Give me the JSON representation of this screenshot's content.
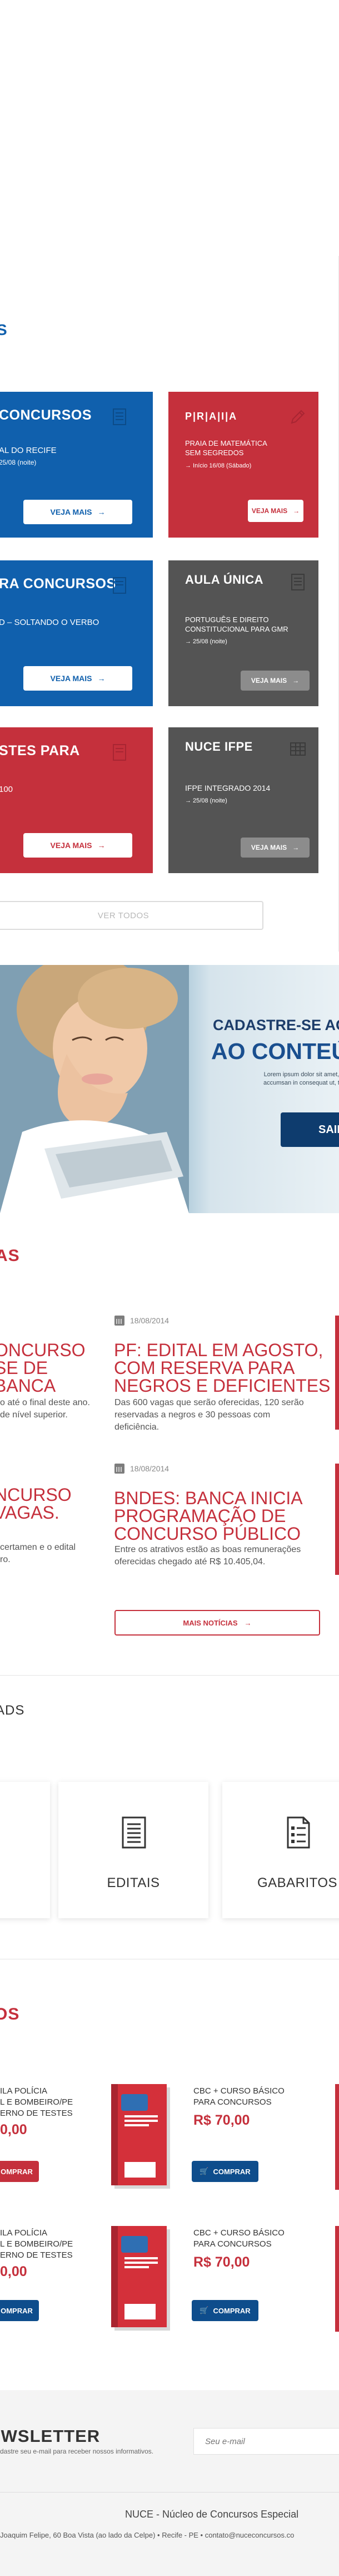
{
  "sections": {
    "courses_title_partial": "S",
    "news_title_partial": "AS",
    "downloads_title_partial": "ADS",
    "products_title_partial": "OS"
  },
  "courses": {
    "card1": {
      "title": " CONCURSOS",
      "line": "AL DO RECIFE",
      "date": "25/08 (noite)",
      "button": "VEJA MAIS"
    },
    "card2": {
      "title": "P|R|A|I|A",
      "line1": "PRAIA DE MATEMÁTICA",
      "line2": "SEM SEGREDOS",
      "date": "→ Início 16/08 (Sábado)",
      "button": "VEJA MAIS"
    },
    "card3": {
      "title": "RA CONCURSOS",
      "line": "D – SOLTANDO O VERBO",
      "button": "VEJA MAIS"
    },
    "card4": {
      "title": "AULA ÚNICA",
      "line1": "PORTUGUÊS E DIREITO",
      "line2": "CONSTITUCIONAL PARA GMR",
      "date": "→ 25/08 (noite)",
      "button": "VEJA MAIS"
    },
    "card5": {
      "title": "STES PARA",
      "line": "100",
      "button": "VEJA MAIS"
    },
    "card6": {
      "title": "NUCE IFPE",
      "line": "IFPE INTEGRADO 2014",
      "date": "→ 25/08 (noite)",
      "button": "VEJA MAIS"
    },
    "see_all": "VER TODOS"
  },
  "banner": {
    "caption": "CADASTRE-SE AG",
    "headline": "AO CONTEÚ",
    "lorem1": "Lorem ipsum dolor sit amet, co",
    "lorem2": "accumsan in consequat ut, tinc",
    "button": "SAIB"
  },
  "news": {
    "left1": {
      "t1": "ONCURSO",
      "t2": "SE DE",
      "t3": "BANCA",
      "d1": "o até o final deste ano.",
      "d2": "de nível superior."
    },
    "item1": {
      "date": "18/08/2014",
      "t1": "PF: EDITAL EM AGOSTO,",
      "t2": "COM RESERVA PARA",
      "t3": "NEGROS E DEFICIENTES",
      "d1": "Das 600 vagas que serão oferecidas, 120 serão",
      "d2": "reservadas a negros e 30 pessoas com",
      "d3": "deficiência."
    },
    "left2": {
      "t1": "NCURSO",
      "t2": "VAGAS.",
      "d1": "certamen e o edital",
      "d2": "ro."
    },
    "item2": {
      "date": "18/08/2014",
      "t1": "BNDES: BANCA INICIA",
      "t2": "PROGRAMAÇÃO DE",
      "t3": "CONCURSO PÚBLICO",
      "d1": "Entre os atrativos estão as boas remunerações",
      "d2": "oferecidas chegado até R$ 10.405,04."
    },
    "more_button": "MAIS NOTÍCIAS"
  },
  "downloads": {
    "card1": "EDITAIS",
    "card2": "GABARITOS"
  },
  "products": {
    "row1_left": {
      "n1": "ILA POLÍCIA",
      "n2": "L E BOMBEIRO/PE",
      "n3": "ERNO DE TESTES",
      "price": "0,00",
      "button": "OMPRAR"
    },
    "row1_right": {
      "n1": "CBC + CURSO BÁSICO",
      "n2": "PARA CONCURSOS",
      "price": "R$ 70,00",
      "button": "COMPRAR"
    },
    "row2_left": {
      "n1": "ILA POLÍCIA",
      "n2": "L E BOMBEIRO/PE",
      "n3": "ERNO DE TESTES",
      "price": "0,00",
      "button": "OMPRAR"
    },
    "row2_right": {
      "n1": "CBC + CURSO BÁSICO",
      "n2": "PARA CONCURSOS",
      "price": "R$ 70,00",
      "button": "COMPRAR"
    }
  },
  "newsletter": {
    "title": "EWSLETTER",
    "subtitle": "dastre seu e-mail para receber nossos informativos.",
    "placeholder": "Seu e-mail"
  },
  "footer": {
    "name": "NUCE - Núcleo de Concursos Especial",
    "address": "Joaquim Felipe, 60 Boa Vista (ao lado da Celpe) • Recife - PE  •  contato@nuceconcursos.co"
  },
  "colors": {
    "blue": "#1060ad",
    "red": "#c5303c",
    "grey": "#545454",
    "navy": "#0e3c6e"
  }
}
